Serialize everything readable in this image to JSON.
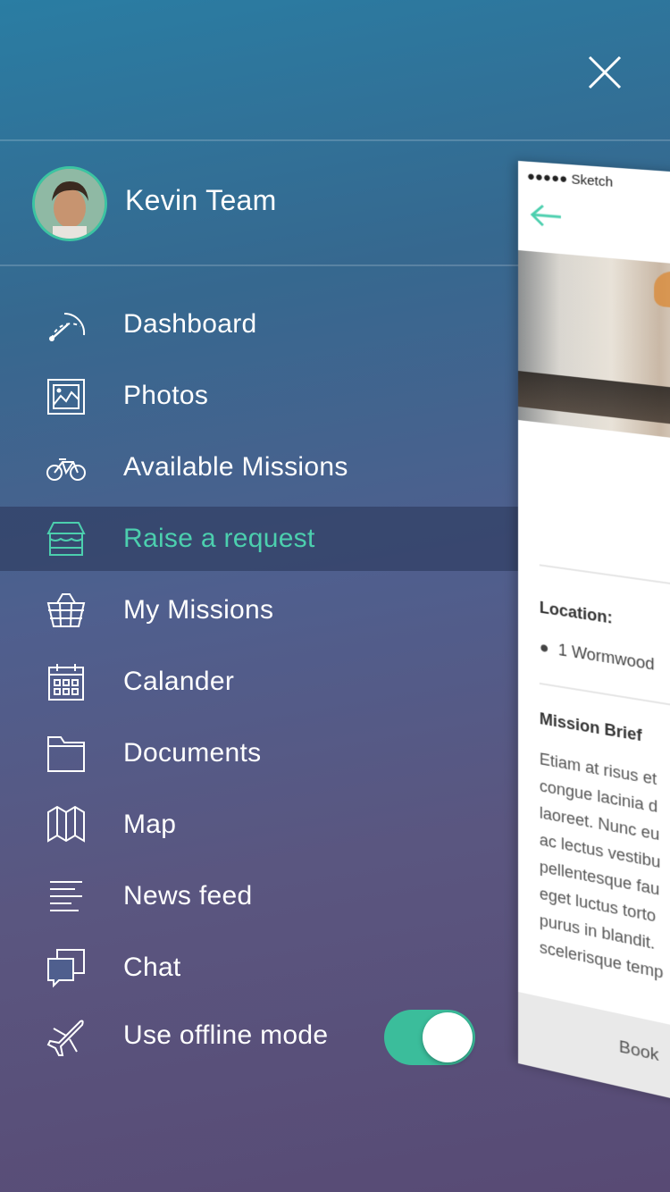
{
  "user": {
    "name": "Kevin Team"
  },
  "menu": [
    {
      "label": "Dashboard",
      "icon": "dashboard-icon"
    },
    {
      "label": "Photos",
      "icon": "photos-icon"
    },
    {
      "label": "Available Missions",
      "icon": "bicycle-icon"
    },
    {
      "label": "Raise a request",
      "icon": "store-icon",
      "active": true
    },
    {
      "label": "My Missions",
      "icon": "basket-icon"
    },
    {
      "label": "Calander",
      "icon": "calendar-icon"
    },
    {
      "label": "Documents",
      "icon": "folder-icon"
    },
    {
      "label": "Map",
      "icon": "map-icon"
    },
    {
      "label": "News feed",
      "icon": "news-feed-icon"
    },
    {
      "label": "Chat",
      "icon": "chat-icon"
    }
  ],
  "offline": {
    "label": "Use offline mode",
    "enabled": true
  },
  "colors": {
    "accent": "#3bbd9b",
    "active_text": "#4ccfae"
  },
  "preview": {
    "status": "●●●●● Sketch",
    "location_label": "Location:",
    "location_value": "1 Wormwood",
    "brief_label": "Mission Brief",
    "brief_lines": [
      "Etiam at risus et",
      "congue lacinia d",
      "laoreet. Nunc eu",
      "ac lectus vestibu",
      "pellentesque fau",
      "eget luctus torto",
      "purus in blandit.",
      "scelerisque temp"
    ],
    "book_label": "Book"
  }
}
